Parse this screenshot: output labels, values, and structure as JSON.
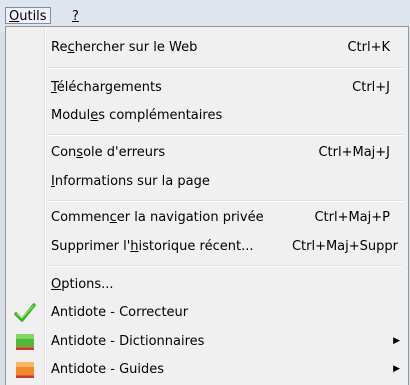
{
  "menubar": {
    "outils": {
      "prefix": "",
      "mnemonic": "O",
      "rest": "utils"
    },
    "help": {
      "prefix": "",
      "mnemonic": "?",
      "rest": ""
    }
  },
  "menu": {
    "items": [
      {
        "pre": "Re",
        "mn": "c",
        "post": "hercher sur le Web",
        "shortcut": "Ctrl+K"
      },
      {
        "pre": "",
        "mn": "T",
        "post": "éléchargements",
        "shortcut": "Ctrl+J"
      },
      {
        "pre": "Modul",
        "mn": "e",
        "post": "s complémentaires",
        "shortcut": ""
      },
      {
        "pre": "Con",
        "mn": "s",
        "post": "ole d'erreurs",
        "shortcut": "Ctrl+Maj+J"
      },
      {
        "pre": "",
        "mn": "I",
        "post": "nformations sur la page",
        "shortcut": ""
      },
      {
        "pre": "Commen",
        "mn": "c",
        "post": "er la navigation privée",
        "shortcut": "Ctrl+Maj+P"
      },
      {
        "pre": "Supprimer l'",
        "mn": "h",
        "post": "istorique récent...",
        "shortcut": "Ctrl+Maj+Suppr"
      },
      {
        "pre": "",
        "mn": "O",
        "post": "ptions...",
        "shortcut": ""
      },
      {
        "pre": "Antidote - Correcteur",
        "mn": "",
        "post": "",
        "shortcut": "",
        "icon": "checkmark-icon"
      },
      {
        "pre": "Antidote - Dictionnaires",
        "mn": "",
        "post": "",
        "shortcut": "",
        "icon": "green-book-icon",
        "submenu": "submenu-arrow-icon"
      },
      {
        "pre": "Antidote - Guides",
        "mn": "",
        "post": "",
        "shortcut": "",
        "icon": "orange-book-icon",
        "submenu": "submenu-arrow-icon"
      }
    ]
  },
  "colors": {
    "check": "#3fae2a",
    "green_book": "#52b83a",
    "orange_book": "#f08a2c"
  }
}
